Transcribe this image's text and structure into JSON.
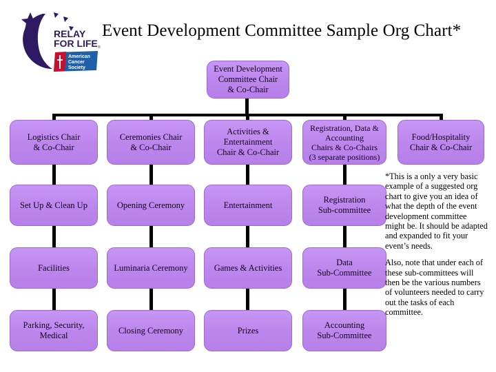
{
  "title": "Event Development Committee Sample Org Chart*",
  "logo": {
    "relay_line1": "RELAY",
    "relay_line2": "FOR LIFE",
    "acs_line1": "American",
    "acs_line2": "Cancer",
    "acs_line3": "Society",
    "crescent_color": "#2e1a63",
    "acs_red": "#c8102e",
    "acs_blue": "#1f5fa8"
  },
  "colors": {
    "node_fill": "#c08ef0",
    "node_border": "#9a6ad0",
    "connector": "#000000",
    "text": "#12001f"
  },
  "chart": {
    "root": "Event Development\nCommittee Chair\n& Co-Chair",
    "columns": [
      {
        "head": "Logistics Chair\n& Co-Chair",
        "children": [
          "Set Up & Clean Up",
          "Facilities",
          "Parking, Security,\nMedical"
        ]
      },
      {
        "head": "Ceremonies Chair\n& Co-Chair",
        "children": [
          "Opening Ceremony",
          "Luminaria Ceremony",
          "Closing Ceremony"
        ]
      },
      {
        "head": "Activities &\nEntertainment\nChair & Co-Chair",
        "children": [
          "Entertainment",
          "Games & Activities",
          "Prizes"
        ]
      },
      {
        "head": "Registration, Data &\nAccounting\nChairs & Co-Chairs\n(3 separate positions)",
        "children": [
          "Registration\nSub-committee",
          "Data\nSub-Committee",
          "Accounting\nSub-Committee"
        ]
      },
      {
        "head": "Food/Hospitality\nChair & Co-Chair",
        "children": []
      }
    ]
  },
  "notes": {
    "paragraph1": "*This is a only a very basic example of a suggested org chart to give you an idea of what the depth of the event development committee might be. It should be adapted and expanded to fit your event’s needs.",
    "paragraph2": "Also, note that under each of these sub-committees will then be the various numbers of volunteers needed to carry out the tasks of each committee."
  }
}
